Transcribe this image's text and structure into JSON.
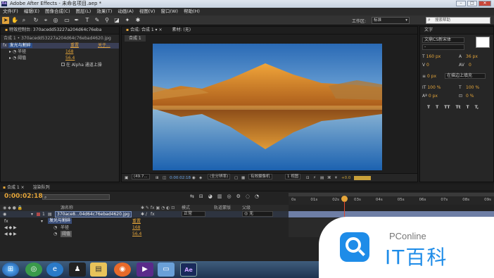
{
  "window": {
    "title": "Adobe After Effects - 未命名项目.aep *",
    "app_icon": "Ae"
  },
  "menu": [
    "文件(F)",
    "编辑(E)",
    "图像合成(C)",
    "图层(L)",
    "效果(T)",
    "动画(A)",
    "视图(V)",
    "窗口(W)",
    "帮助(H)"
  ],
  "workspace": {
    "label": "工作区:",
    "value": "标准",
    "search_placeholder": "搜索帮助"
  },
  "effects_panel": {
    "tab": "特效控制台: 370acedd53227a204d64c76eba",
    "subtitle": "合成 1 • 370acedd53227a204d64c76ebad4620.jpg",
    "effect_name": "发光与割碎",
    "reset": "重置",
    "about": "关于...",
    "props": [
      {
        "label": "半径",
        "value": "168"
      },
      {
        "label": "阈值",
        "value": "56.4"
      }
    ],
    "alpha_label": "在 Alpha 通道上操"
  },
  "comp_panel": {
    "tab": "合成: 合成 1",
    "footage_tab": "素材: (无)",
    "sub_tab": "合成 1",
    "zoom": "(49.7...",
    "timecode": "0:00:02:18",
    "quality": "(全分辨率)",
    "camera": "有效摄像机",
    "views": "1 视图",
    "exposure": "+0.0"
  },
  "char_panel": {
    "tab": "文字",
    "font": "文鼎CS新宋体",
    "font_style": "-",
    "size": "160 px",
    "leading": "36 px",
    "kerning": "0",
    "tracking": "0",
    "stroke_width": "0 px",
    "stroke_type": "在描边上填充",
    "vscale": "100 %",
    "hscale": "100 %",
    "baseline": "0 px",
    "tsume": "0 %",
    "styles": [
      "T",
      "T",
      "TT",
      "Tt",
      "T",
      "T,"
    ]
  },
  "timeline": {
    "tabs": [
      "合成 1",
      "渲染队列"
    ],
    "timecode": "0:00:02:18",
    "search_placeholder": "",
    "columns": {
      "source": "源名称",
      "mode": "模式",
      "trkmat": "轨道蒙版",
      "parent": "父级"
    },
    "layer": {
      "index": "1",
      "name": "370ace8...04d64c76ebad4620.jpg",
      "mode": "正常",
      "parent": "无"
    },
    "fx_label": "fx",
    "effect_name": "发光与割碎",
    "effect_reset": "重置",
    "props": [
      {
        "label": "半径",
        "value": "168"
      },
      {
        "label": "阈值",
        "value": "56.4"
      }
    ],
    "ruler": [
      "0s",
      "01s",
      "02s",
      "03s",
      "04s",
      "05s",
      "06s",
      "07s",
      "08s",
      "09s"
    ]
  },
  "watermark": {
    "brand": "PConline",
    "logo_text": "IT百科"
  },
  "colors": {
    "accent": "#e4a53a",
    "panel": "#262626",
    "timecode": "#e4a53a",
    "layer_bar": "#6e7ea5",
    "indicator": "#e0482e"
  }
}
